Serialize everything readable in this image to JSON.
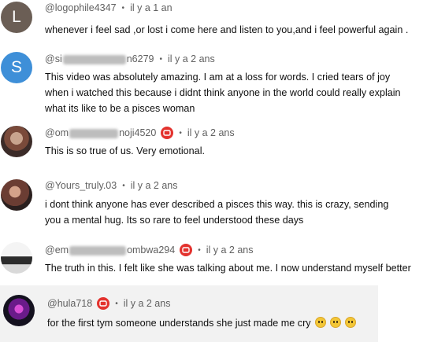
{
  "comments": [
    {
      "author": "@logophile4347",
      "time": "il y a 1 an",
      "avatar_letter": "L",
      "avatar_color": "#6b5e55",
      "text": "whenever i feel sad ,or lost i come here and listen to you,and i feel powerful again ."
    },
    {
      "author_start": "@si",
      "author_end": "n6279",
      "time": "il y a 2 ans",
      "avatar_letter": "S",
      "avatar_color": "#3e8fd8",
      "text": "This video was absolutely amazing. I am at a loss for words. I cried tears of joy\nwhen i watched this because i didnt think anyone in the world could really explain\nwhat its like to be a pisces woman"
    },
    {
      "author_start": "@om",
      "author_end": "noji4520",
      "time": "il y a 2 ans",
      "badge": "recording-badge-icon",
      "text": "This is so true of us. Very emotional."
    },
    {
      "author": "@Yours_truly.03",
      "time": "il y a 2 ans",
      "text": "i dont think anyone has ever described a pisces this way. this is crazy, sending\nyou a mental hug. Its so rare to feel understood these days"
    },
    {
      "author_start": "@em",
      "author_end": "ombwa294",
      "time": "il y a 2 ans",
      "badge": "recording-badge-icon",
      "text": "The truth in this. I felt like she was talking about me. I now understand myself better"
    },
    {
      "author": "@hula718",
      "time": "il y a 2 ans",
      "badge": "recording-badge-icon",
      "text": "for the first tym someone understands she just made me cry",
      "emojis": [
        "pleading-face-emoji",
        "pleading-face-emoji",
        "pleading-face-emoji"
      ]
    }
  ],
  "colors": {
    "badge_red": "#e3322e",
    "meta_gray": "#606060",
    "highlight_bg": "#f2f2f2"
  }
}
